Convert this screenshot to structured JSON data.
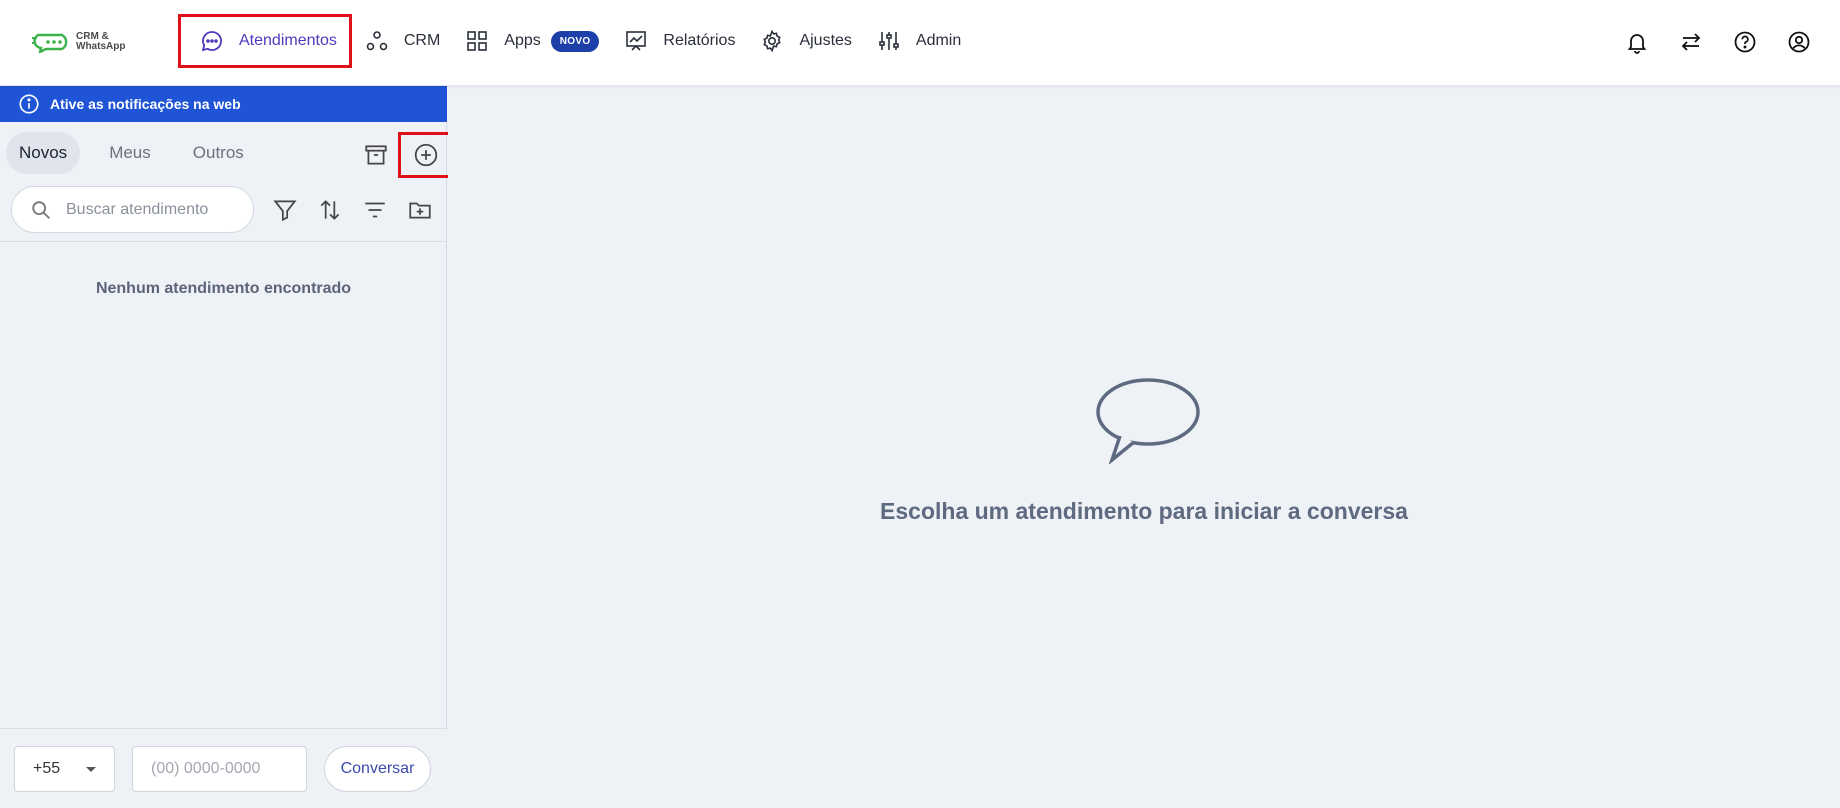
{
  "logo": {
    "line1": "CRM &",
    "line2": "WhatsApp"
  },
  "nav": {
    "items": [
      {
        "label": "Atendimentos",
        "icon": "chat-dots-icon",
        "active": true
      },
      {
        "label": "CRM",
        "icon": "circles-icon"
      },
      {
        "label": "Apps",
        "icon": "grid-icon",
        "badge": "NOVO"
      },
      {
        "label": "Relatórios",
        "icon": "presentation-chart-icon"
      },
      {
        "label": "Ajustes",
        "icon": "gear-icon"
      },
      {
        "label": "Admin",
        "icon": "sliders-icon"
      }
    ],
    "right_icons": [
      "bell-icon",
      "transfer-arrows-icon",
      "help-circle-icon",
      "user-circle-icon"
    ]
  },
  "notice": {
    "text": "Ative as notificações na web"
  },
  "tabs": [
    {
      "label": "Novos",
      "active": true
    },
    {
      "label": "Meus"
    },
    {
      "label": "Outros"
    }
  ],
  "search": {
    "placeholder": "Buscar atendimento"
  },
  "list": {
    "empty_text": "Nenhum atendimento encontrado"
  },
  "bottom": {
    "country_code": "+55",
    "phone_placeholder": "(00) 0000-0000",
    "button_label": "Conversar"
  },
  "main": {
    "empty_text": "Escolha um atendimento para iniciar a conversa"
  },
  "colors": {
    "primary": "#1f54d6",
    "active_nav": "#4b3bbd",
    "highlight": "#e0101a",
    "badge": "#1c3fa8",
    "muted_text": "#5e6a80"
  }
}
